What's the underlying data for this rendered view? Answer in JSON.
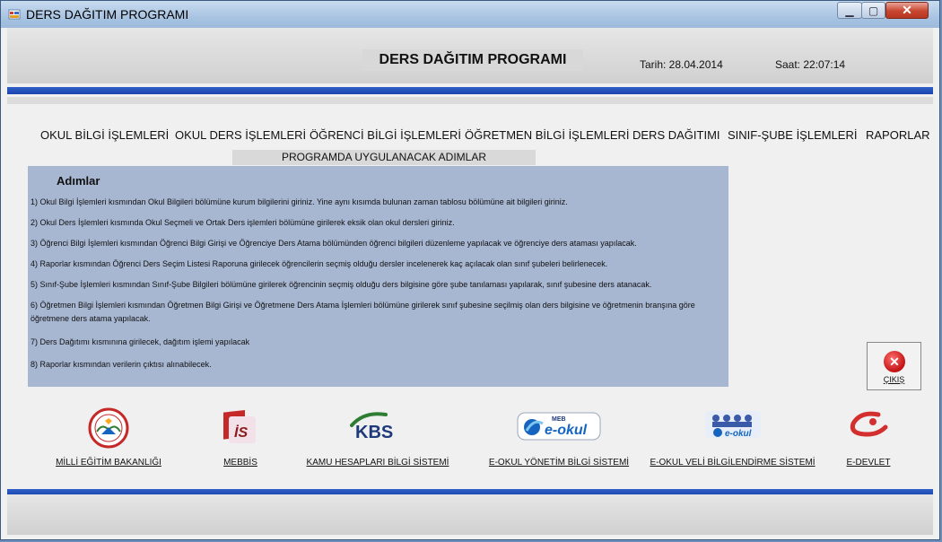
{
  "window": {
    "title": "DERS DAĞITIM PROGRAMI",
    "min_glyph": "▁",
    "max_glyph": "▢",
    "close_glyph": "✕"
  },
  "header": {
    "program_title": "DERS DAĞITIM PROGRAMI",
    "date_label": "Tarih: 28.04.2014",
    "time_label": "Saat: 22:07:14"
  },
  "menu": [
    "OKUL BİLGİ İŞLEMLERİ",
    "OKUL DERS İŞLEMLERİ",
    "ÖĞRENCİ BİLGİ İŞLEMLERİ",
    "ÖĞRETMEN BİLGİ İŞLEMLERİ",
    "DERS DAĞITIMI",
    "SINIF-ŞUBE İŞLEMLERİ",
    "RAPORLAR"
  ],
  "section_title": "PROGRAMDA UYGULANACAK ADIMLAR",
  "steps": {
    "heading": "Adımlar",
    "items": [
      "1) Okul Bilgi İşlemleri kısmından Okul Bilgileri bölümüne kurum bilgilerini giriniz. Yine aynı kısımda bulunan zaman tablosu bölümüne ait bilgileri giriniz.",
      "2) Okul Ders İşlemleri kısmında Okul Seçmeli ve Ortak Ders işlemleri bölümüne girilerek eksik olan okul dersleri giriniz.",
      "3) Öğrenci Bilgi İşlemleri kısmından Öğrenci Bilgi Girişi ve Öğrenciye Ders Atama bölümünden öğrenci bilgileri düzenleme yapılacak ve öğrenciye ders ataması yapılacak.",
      "4) Raporlar kısmından Öğrenci Ders Seçim Listesi Raporuna girilecek öğrencilerin seçmiş olduğu dersler incelenerek kaç açılacak olan sınıf şubeleri belirlenecek.",
      "5) Sınıf-Şube İşlemleri kısmından Sınıf-Şube Bilgileri bölümüne girilerek öğrencinin seçmiş olduğu ders bilgisine göre şube tanılaması yapılarak, sınıf şubesine ders atanacak.",
      "6) Öğretmen Bilgi İşlemleri kısmından Öğretmen Bilgi Girişi ve Öğretmene Ders Atama İşlemleri bölümüne girilerek sınıf şubesine seçilmiş olan ders bilgisine ve öğretmenin branşına göre öğretmene ders atama yapılacak.",
      "7) Ders Dağıtımı kısmınına girilecek, dağıtım işlemi yapılacak",
      "8) Raporlar kısmından verilerin çıktısı alınabilecek."
    ]
  },
  "exit_button": {
    "label": "ÇIKIŞ",
    "icon": "close-circle-icon"
  },
  "links": [
    {
      "label": "MİLLİ EĞİTİM BAKANLIĞI",
      "icon": "meb-logo-icon"
    },
    {
      "label": "MEBBİS",
      "icon": "mebbis-logo-icon",
      "logo_text": "İS"
    },
    {
      "label": "KAMU HESAPLARI BİLGİ SİSTEMİ",
      "icon": "kbs-logo-icon",
      "logo_text": "KBS"
    },
    {
      "label": "E-OKUL YÖNETİM BİLGİ SİSTEMİ",
      "icon": "e-okul-logo-icon",
      "logo_text": "e-okul",
      "logo_small": "MEB"
    },
    {
      "label": "E-OKUL VELİ BİLGİLENDİRME SİSTEMİ",
      "icon": "e-okul-veli-logo-icon",
      "logo_text": "e-okul"
    },
    {
      "label": "E-DEVLET",
      "icon": "e-devlet-logo-icon"
    }
  ],
  "colors": {
    "accent_blue": "#1a44b0",
    "panel": "#a7b7d2",
    "exit_red": "#c21313"
  }
}
